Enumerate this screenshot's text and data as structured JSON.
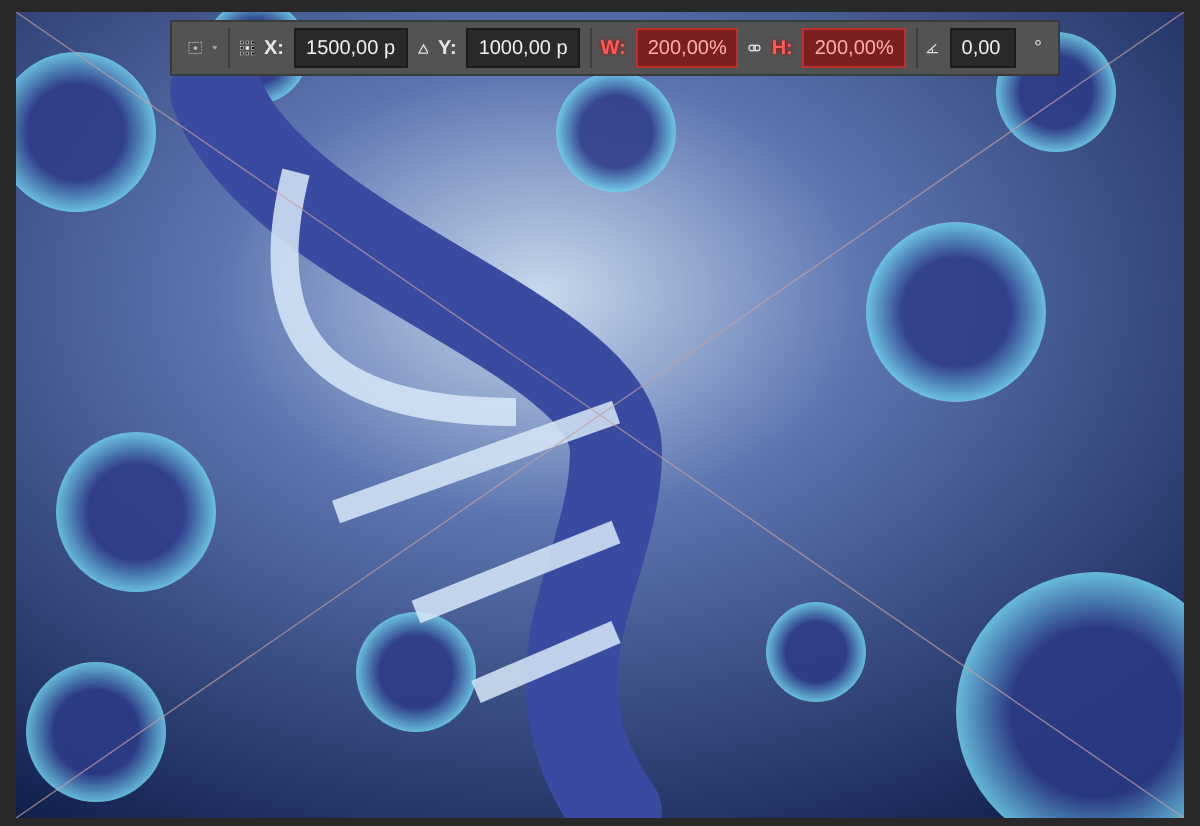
{
  "toolbar": {
    "position_fields": [
      {
        "label": "X:",
        "value": "1500,00 p",
        "highlighted": false
      },
      {
        "label": "Y:",
        "value": "1000,00 p",
        "highlighted": false
      }
    ],
    "size_fields": [
      {
        "label": "W:",
        "value": "200,00%",
        "highlighted": true
      },
      {
        "label": "H:",
        "value": "200,00%",
        "highlighted": true
      }
    ],
    "rotation": {
      "value": "0,00",
      "unit": "°"
    }
  }
}
